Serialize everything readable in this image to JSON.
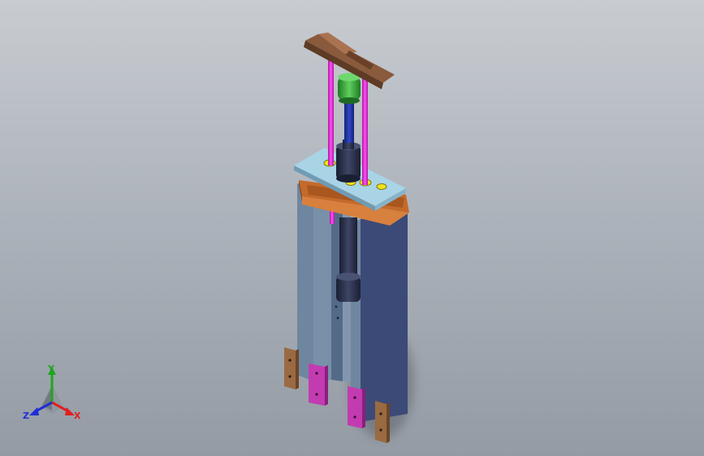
{
  "viewport": {
    "background_top": "#c8ccd1",
    "background_bottom": "#949ba4"
  },
  "triad": {
    "x_label": "X",
    "y_label": "Y",
    "z_label": "Z",
    "x_color": "#e0201f",
    "y_color": "#1fa51f",
    "z_color": "#1f2fd6"
  },
  "model": {
    "handle_color": "#8a5a3c",
    "rod_color": "#e024d8",
    "top_plate_color": "#a8d4e6",
    "frame_color": "#3c4a78",
    "frame_side_color": "#6f86a0",
    "beam_color": "#c46a2a",
    "pad_color": "#c23bb0",
    "foot_color": "#9a6a42",
    "cylinder_color": "#2b3148",
    "motor_color": "#3aa53a",
    "washer_color": "#f0e21a"
  }
}
